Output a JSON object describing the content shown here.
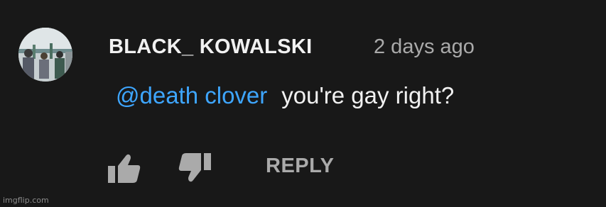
{
  "comment": {
    "author": "BLACK_ KOWALSKI",
    "timestamp": "2 days ago",
    "mention": "@death clover",
    "text": "you're gay right?",
    "avatar_icon": "user-avatar-photo"
  },
  "actions": {
    "like_icon": "thumbs-up-icon",
    "dislike_icon": "thumbs-down-icon",
    "reply_label": "REPLY"
  },
  "watermark": "imgflip.com",
  "colors": {
    "background": "#181818",
    "mention": "#3ea6ff",
    "primary_text": "#f1f1f1",
    "secondary_text": "#aaaaaa"
  }
}
